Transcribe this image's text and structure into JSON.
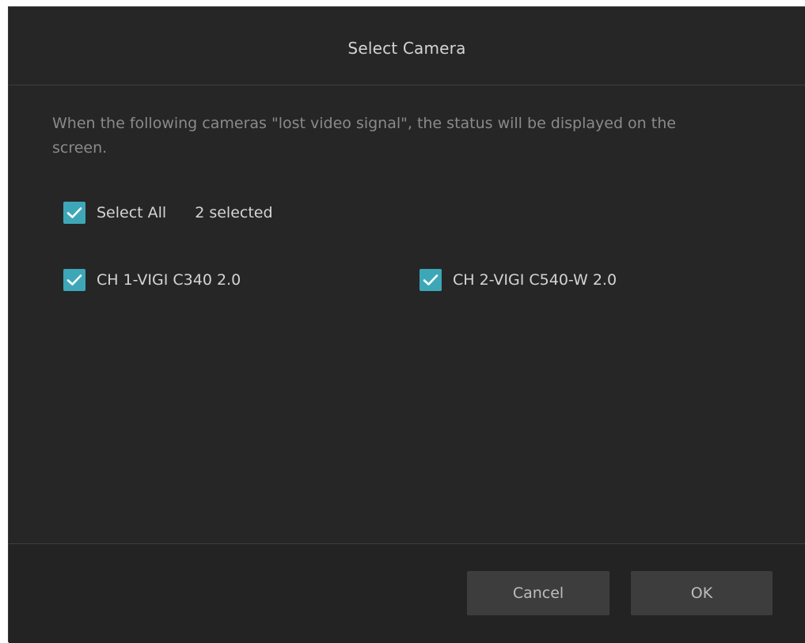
{
  "dialog": {
    "title": "Select Camera",
    "description": "When the following cameras \"lost video signal\", the status will be displayed on the screen."
  },
  "select_all": {
    "label": "Select All",
    "checked": true,
    "count_text": "2 selected"
  },
  "cameras": [
    {
      "label": "CH 1-VIGI C340 2.0",
      "checked": true
    },
    {
      "label": "CH 2-VIGI C540-W 2.0",
      "checked": true
    }
  ],
  "buttons": {
    "cancel": "Cancel",
    "ok": "OK"
  },
  "colors": {
    "background": "#262626",
    "checkbox_accent": "#3ea7b7",
    "button": "#3d3d3d"
  },
  "icons": {
    "checkbox": "checkmark-icon"
  }
}
